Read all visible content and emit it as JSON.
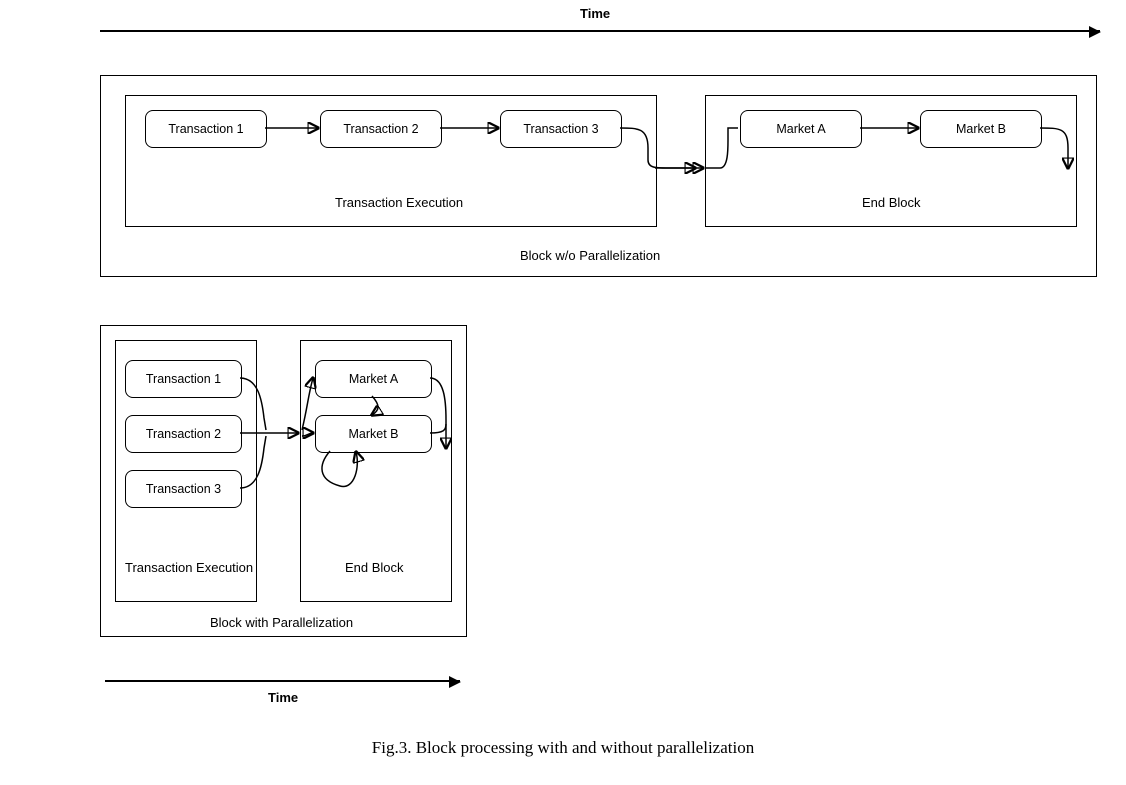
{
  "timeLabelTop": "Time",
  "timeLabelBottom": "Time",
  "top": {
    "outerTitle": "Block w/o Parallelization",
    "execTitle": "Transaction Execution",
    "endTitle": "End Block",
    "nodes": {
      "t1": "Transaction 1",
      "t2": "Transaction 2",
      "t3": "Transaction 3",
      "mA": "Market A",
      "mB": "Market B"
    }
  },
  "bottom": {
    "outerTitle": "Block with Parallelization",
    "execTitle": "Transaction Execution",
    "endTitle": "End Block",
    "nodes": {
      "t1": "Transaction 1",
      "t2": "Transaction 2",
      "t3": "Transaction 3",
      "mA": "Market A",
      "mB": "Market B"
    }
  },
  "caption": "Fig.3. Block processing with and without parallelization"
}
